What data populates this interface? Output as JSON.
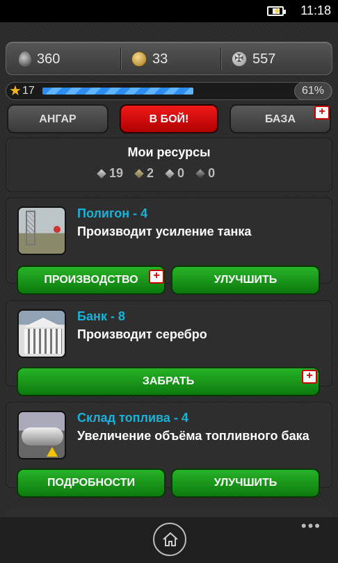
{
  "status_bar": {
    "time": "11:18",
    "battery_icon": "battery-charging-icon"
  },
  "currency": {
    "fuel": {
      "value": "360",
      "icon": "fuel-drop-icon"
    },
    "gold": {
      "value": "33",
      "icon": "gold-coin-icon"
    },
    "silver": {
      "value": "557",
      "icon": "silver-coin-icon"
    }
  },
  "xp": {
    "level": "17",
    "percent_label": "61%",
    "progress": 0.61
  },
  "nav": {
    "hangar": "АНГАР",
    "battle": "В БОЙ!",
    "base": "БАЗА",
    "base_badge": "+"
  },
  "resources": {
    "title": "Мои ресурсы",
    "items": [
      {
        "icon": "resource-cube-gray-icon",
        "count": "19"
      },
      {
        "icon": "resource-cube-khaki-icon",
        "count": "2"
      },
      {
        "icon": "resource-cube-white-icon",
        "count": "0"
      },
      {
        "icon": "resource-cube-dark-icon",
        "count": "0"
      }
    ]
  },
  "buildings": [
    {
      "name": "Полигон - 4",
      "description": "Производит усиление танка",
      "buttons": [
        {
          "label": "ПРОИЗВОДСТВО",
          "badge": "+"
        },
        {
          "label": "УЛУЧШИТЬ"
        }
      ]
    },
    {
      "name": "Банк - 8",
      "description": "Производит серебро",
      "buttons": [
        {
          "label": "ЗАБРАТЬ",
          "badge": "+"
        }
      ]
    },
    {
      "name": "Склад топлива - 4",
      "description": "Увеличение объёма топливного бака",
      "buttons": [
        {
          "label": "ПОДРОБНОСТИ"
        },
        {
          "label": "УЛУЧШИТЬ"
        }
      ]
    }
  ],
  "appbar": {
    "home_icon": "home-icon",
    "more_label": "•••"
  },
  "colors": {
    "accent_cyan": "#1ab2d8",
    "green_button": "#1a9a1a",
    "red_button": "#d81010",
    "xp_blue": "#2c8cf0"
  }
}
